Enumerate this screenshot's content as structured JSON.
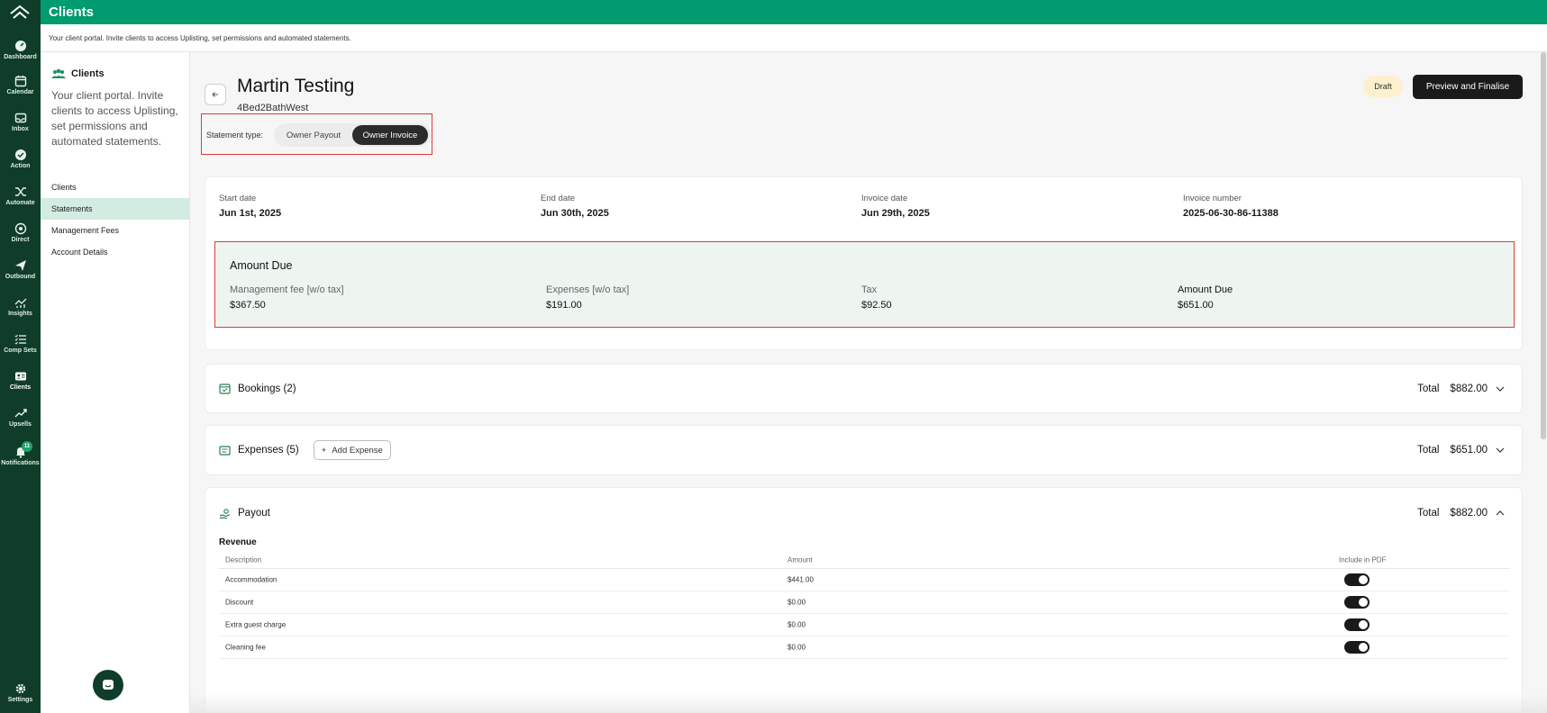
{
  "app": {
    "title": "Clients",
    "subtitle": "Your client portal. Invite clients to access Uplisting, set permissions and automated statements."
  },
  "rail": {
    "items": [
      {
        "label": "Dashboard",
        "icon": "dashboard-icon"
      },
      {
        "label": "Calendar",
        "icon": "calendar-icon"
      },
      {
        "label": "Inbox",
        "icon": "inbox-icon"
      },
      {
        "label": "Action",
        "icon": "action-check-icon"
      },
      {
        "label": "Automate",
        "icon": "shuffle-icon"
      },
      {
        "label": "Direct",
        "icon": "direct-icon"
      },
      {
        "label": "Outbound",
        "icon": "paper-plane-icon"
      },
      {
        "label": "Insights",
        "icon": "insights-chart-icon"
      },
      {
        "label": "Comp Sets",
        "icon": "list-icon"
      },
      {
        "label": "Clients",
        "icon": "clients-card-icon"
      },
      {
        "label": "Upsells",
        "icon": "trend-up-icon"
      },
      {
        "label": "Notifications",
        "icon": "bell-icon"
      }
    ],
    "notification_count": "11",
    "settings_label": "Settings"
  },
  "subsidebar": {
    "title": "Clients",
    "description": "Your client portal. Invite clients to access Uplisting, set permissions and automated statements.",
    "nav": [
      "Clients",
      "Statements",
      "Management Fees",
      "Account Details"
    ]
  },
  "statement": {
    "client_name": "Martin Testing",
    "property": "4Bed2BathWest",
    "status": "Draft",
    "preview_button": "Preview and Finalise",
    "type_label": "Statement type:",
    "type_options": [
      "Owner Payout",
      "Owner Invoice"
    ],
    "info": [
      {
        "label": "Start date",
        "value": "Jun 1st, 2025"
      },
      {
        "label": "End date",
        "value": "Jun 30th, 2025"
      },
      {
        "label": "Invoice date",
        "value": "Jun 29th, 2025"
      },
      {
        "label": "Invoice number",
        "value": "2025-06-30-86-11388"
      }
    ],
    "amount_due": {
      "title": "Amount Due",
      "items": [
        {
          "label": "Management fee [w/o tax]",
          "value": "$367.50"
        },
        {
          "label": "Expenses [w/o tax]",
          "value": "$191.00"
        },
        {
          "label": "Tax",
          "value": "$92.50"
        },
        {
          "label": "Amount Due",
          "value": "$651.00"
        }
      ]
    },
    "bookings": {
      "label": "Bookings (2)",
      "total_label": "Total",
      "total": "$882.00"
    },
    "expenses": {
      "label": "Expenses (5)",
      "add_label": "Add Expense",
      "total_label": "Total",
      "total": "$651.00"
    },
    "payout": {
      "label": "Payout",
      "total_label": "Total",
      "total": "$882.00",
      "revenue_title": "Revenue",
      "columns": [
        "Description",
        "Amount",
        "Include in PDF"
      ],
      "rows": [
        {
          "description": "Accommodation",
          "amount": "$441.00",
          "include": true
        },
        {
          "description": "Discount",
          "amount": "$0.00",
          "include": true
        },
        {
          "description": "Extra guest charge",
          "amount": "$0.00",
          "include": true
        },
        {
          "description": "Cleaning fee",
          "amount": "$0.00",
          "include": true
        }
      ]
    }
  }
}
